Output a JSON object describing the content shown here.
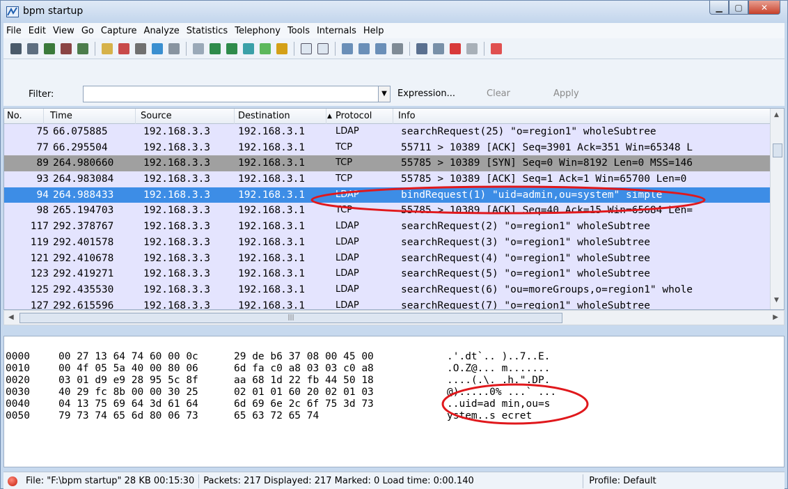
{
  "window": {
    "title": "bpm startup"
  },
  "menu": [
    "File",
    "Edit",
    "View",
    "Go",
    "Capture",
    "Analyze",
    "Statistics",
    "Telephony",
    "Tools",
    "Internals",
    "Help"
  ],
  "filter": {
    "label": "Filter:",
    "value": "",
    "expression": "Expression...",
    "clear": "Clear",
    "apply": "Apply"
  },
  "columns": {
    "no": "No.",
    "time": "Time",
    "source": "Source",
    "destination": "Destination",
    "protocol": "Protocol",
    "info": "Info"
  },
  "packets": [
    {
      "no": "75",
      "time": "66.075885",
      "src": "192.168.3.3",
      "dst": "192.168.3.1",
      "proto": "LDAP",
      "info": "searchRequest(25) \"o=region1\" wholeSubtree",
      "style": "lav"
    },
    {
      "no": "77",
      "time": "66.295504",
      "src": "192.168.3.3",
      "dst": "192.168.3.1",
      "proto": "TCP",
      "info": "55711 > 10389 [ACK] Seq=3901 Ack=351 Win=65348 L",
      "style": "lav"
    },
    {
      "no": "89",
      "time": "264.980660",
      "src": "192.168.3.3",
      "dst": "192.168.3.1",
      "proto": "TCP",
      "info": "55785 > 10389 [SYN] Seq=0 Win=8192 Len=0 MSS=146",
      "style": "gray"
    },
    {
      "no": "93",
      "time": "264.983084",
      "src": "192.168.3.3",
      "dst": "192.168.3.1",
      "proto": "TCP",
      "info": "55785 > 10389 [ACK] Seq=1 Ack=1 Win=65700 Len=0",
      "style": "lav"
    },
    {
      "no": "94",
      "time": "264.988433",
      "src": "192.168.3.3",
      "dst": "192.168.3.1",
      "proto": "LDAP",
      "info": "bindRequest(1) \"uid=admin,ou=system\" simple",
      "style": "sel"
    },
    {
      "no": "98",
      "time": "265.194703",
      "src": "192.168.3.3",
      "dst": "192.168.3.1",
      "proto": "TCP",
      "info": "55785 > 10389 [ACK] Seq=40 Ack=15 Win=65684 Len=",
      "style": "lav"
    },
    {
      "no": "117",
      "time": "292.378767",
      "src": "192.168.3.3",
      "dst": "192.168.3.1",
      "proto": "LDAP",
      "info": "searchRequest(2) \"o=region1\" wholeSubtree",
      "style": "lav"
    },
    {
      "no": "119",
      "time": "292.401578",
      "src": "192.168.3.3",
      "dst": "192.168.3.1",
      "proto": "LDAP",
      "info": "searchRequest(3) \"o=region1\" wholeSubtree",
      "style": "lav"
    },
    {
      "no": "121",
      "time": "292.410678",
      "src": "192.168.3.3",
      "dst": "192.168.3.1",
      "proto": "LDAP",
      "info": "searchRequest(4) \"o=region1\" wholeSubtree",
      "style": "lav"
    },
    {
      "no": "123",
      "time": "292.419271",
      "src": "192.168.3.3",
      "dst": "192.168.3.1",
      "proto": "LDAP",
      "info": "searchRequest(5) \"o=region1\" wholeSubtree",
      "style": "lav"
    },
    {
      "no": "125",
      "time": "292.435530",
      "src": "192.168.3.3",
      "dst": "192.168.3.1",
      "proto": "LDAP",
      "info": "searchRequest(6) \"ou=moreGroups,o=region1\" whole",
      "style": "lav"
    },
    {
      "no": "127",
      "time": "292.615596",
      "src": "192.168.3.3",
      "dst": "192.168.3.1",
      "proto": "LDAP",
      "info": "searchRequest(7) \"o=region1\" wholeSubtree",
      "style": "lav"
    }
  ],
  "hex": [
    {
      "off": "0000",
      "b1": "00 27 13 64 74 60 00 0c",
      "b2": "29 de b6 37 08 00 45 00",
      "ascii": ".'.dt`.. )..7..E."
    },
    {
      "off": "0010",
      "b1": "00 4f 05 5a 40 00 80 06",
      "b2": "6d fa c0 a8 03 03 c0 a8",
      "ascii": ".O.Z@... m......."
    },
    {
      "off": "0020",
      "b1": "03 01 d9 e9 28 95 5c 8f",
      "b2": "aa 68 1d 22 fb 44 50 18",
      "ascii": "....(.\\. .h.\".DP."
    },
    {
      "off": "0030",
      "b1": "40 29 fc 8b 00 00 30 25",
      "b2": "02 01 01 60 20 02 01 03",
      "ascii": "@).....0% ...` ..."
    },
    {
      "off": "0040",
      "b1": "04 13 75 69 64 3d 61 64",
      "b2": "6d 69 6e 2c 6f 75 3d 73",
      "ascii": "..uid=ad min,ou=s"
    },
    {
      "off": "0050",
      "b1": "79 73 74 65 6d 80 06 73",
      "b2": "65 63 72 65 74",
      "ascii": "ystem..s ecret"
    }
  ],
  "status": {
    "file": "File: \"F:\\bpm startup\" 28 KB 00:15:30",
    "packets": "Packets: 217 Displayed: 217 Marked: 0 Load time: 0:00.140",
    "profile": "Profile: Default"
  },
  "colors": {
    "lavender": "#e4e4fe",
    "selected": "#3d8de6",
    "syn_gray": "#a0a0a0",
    "annotation": "#e0181c"
  }
}
